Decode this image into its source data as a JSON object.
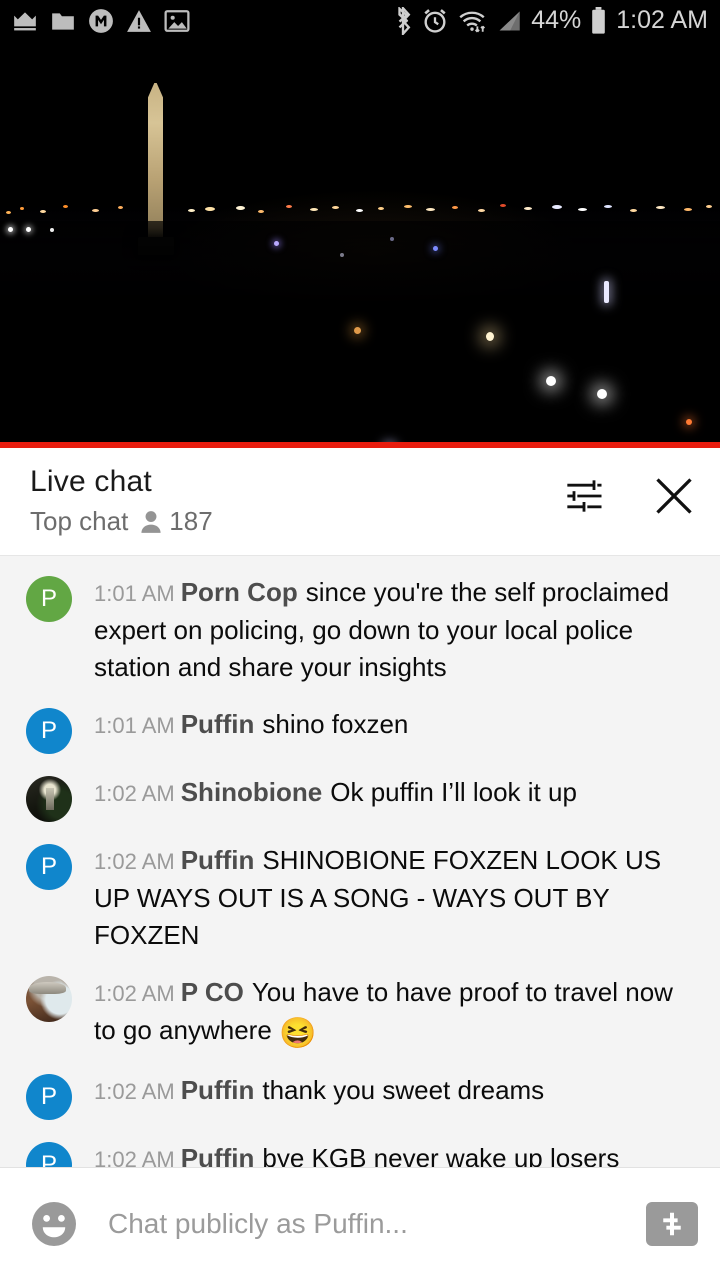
{
  "status_bar": {
    "left_icons": [
      "crown-icon",
      "folder-icon",
      "m-circle-icon",
      "warning-triangle-icon",
      "image-icon"
    ],
    "right_icons": [
      "bluetooth-icon",
      "alarm-icon",
      "wifi-icon",
      "cell-signal-icon",
      "battery-icon"
    ],
    "battery_percent": "44%",
    "time": "1:02 AM"
  },
  "video": {
    "description": "night-cityscape-washington-monument",
    "progress_color": "#e81c0e"
  },
  "chat_header": {
    "title": "Live chat",
    "mode": "Top chat",
    "viewers": "187",
    "settings_icon": "sliders-icon",
    "close_icon": "close-icon"
  },
  "messages": [
    {
      "time": "1:01 AM",
      "author": "Porn Cop",
      "text": "since you're the self proclaimed expert on policing, go down to your local police station and share your insights",
      "avatar_type": "initial",
      "avatar_letter": "P",
      "avatar_color": "#62a744"
    },
    {
      "time": "1:01 AM",
      "author": "Puffin",
      "text": "shino foxzen",
      "avatar_type": "initial",
      "avatar_letter": "P",
      "avatar_color": "#1086cc"
    },
    {
      "time": "1:02 AM",
      "author": "Shinobione",
      "text": "Ok puffin I’ll look it up",
      "avatar_type": "photo-dark-lamp",
      "avatar_letter": "",
      "avatar_color": "#1b1b16"
    },
    {
      "time": "1:02 AM",
      "author": "Puffin",
      "text": "SHINOBIONE FOXZEN LOOK US UP WAYS OUT IS A SONG - WAYS OUT BY FOXZEN",
      "avatar_type": "initial",
      "avatar_letter": "P",
      "avatar_color": "#1086cc"
    },
    {
      "time": "1:02 AM",
      "author": "P CO",
      "text": "You have to have proof to travel now to go anywhere ",
      "emoji": "😆",
      "avatar_type": "photo-man-cap",
      "avatar_letter": "",
      "avatar_color": "#6d4c36"
    },
    {
      "time": "1:02 AM",
      "author": "Puffin",
      "text": "thank you sweet dreams",
      "avatar_type": "initial",
      "avatar_letter": "P",
      "avatar_color": "#1086cc"
    },
    {
      "time": "1:02 AM",
      "author": "Puffin",
      "text": "bye KGB never wake up losers",
      "avatar_type": "initial",
      "avatar_letter": "P",
      "avatar_color": "#1086cc"
    }
  ],
  "input_bar": {
    "emoji_icon": "emoji-smiley-icon",
    "placeholder": "Chat publicly as Puffin...",
    "value": "",
    "superchat_icon": "dollar-icon"
  }
}
